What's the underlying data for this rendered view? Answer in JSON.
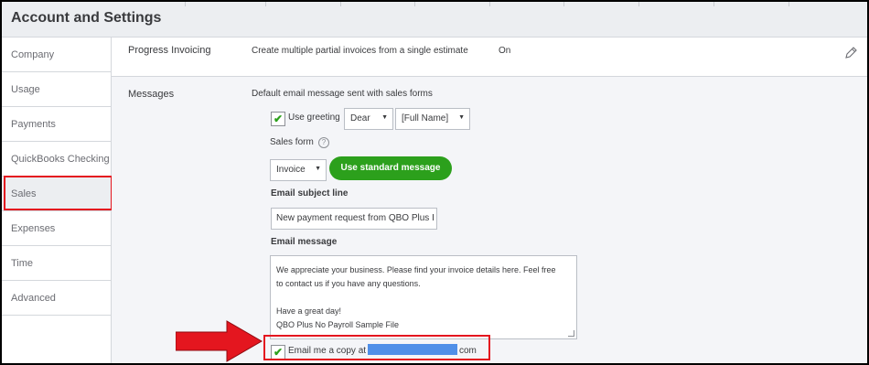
{
  "header": {
    "title": "Account and Settings"
  },
  "sidebar": {
    "items": [
      {
        "label": "Company"
      },
      {
        "label": "Usage"
      },
      {
        "label": "Payments"
      },
      {
        "label": "QuickBooks Checking"
      },
      {
        "label": "Sales"
      },
      {
        "label": "Expenses"
      },
      {
        "label": "Time"
      },
      {
        "label": "Advanced"
      }
    ],
    "active": "Sales"
  },
  "progress": {
    "label": "Progress Invoicing",
    "description": "Create multiple partial invoices from a single estimate",
    "status": "On",
    "edit_icon": "pencil-icon"
  },
  "messages": {
    "label": "Messages",
    "description": "Default email message sent with sales forms",
    "use_greeting": {
      "label": "Use greeting",
      "checked": true
    },
    "greeting_select": "Dear",
    "name_select": "[Full Name]",
    "sales_form_label": "Sales form",
    "help_icon_glyph": "?",
    "sales_form_select": "Invoice",
    "use_standard_button": "Use standard message",
    "subject_label": "Email subject line",
    "subject_value": "New payment request from QBO Plus I",
    "message_label": "Email message",
    "message_lines": [
      "We appreciate your business. Please find your invoice details here. Feel free",
      "to contact us if you have any questions.",
      "",
      "Have a great day!",
      "QBO Plus No Payroll Sample File"
    ],
    "copy_label": "Email me a copy at",
    "copy_suffix": "com",
    "copy_checked": true
  },
  "annotations": {
    "highlight_color": "#e4161f",
    "arrow_color": "#e4161f"
  },
  "colors": {
    "accent_green": "#2ca01c",
    "redaction": "#4f8fe8"
  }
}
